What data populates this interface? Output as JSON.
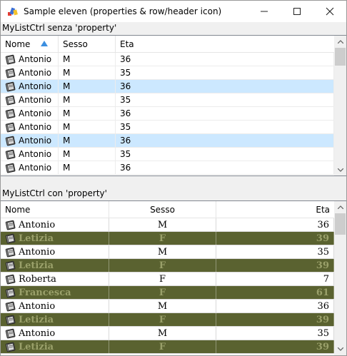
{
  "window": {
    "title": "Sample eleven (properties & row/header icon)",
    "controls": {
      "minimize": "minimize-icon",
      "maximize": "maximize-icon",
      "close": "close-icon"
    }
  },
  "list1": {
    "label": "MyListCtrl senza 'property'",
    "columns": [
      "Nome",
      "Sesso",
      "Eta"
    ],
    "sort_column": "Nome",
    "sort_direction": "ascending",
    "rows": [
      {
        "nome": "Antonio",
        "sesso": "M",
        "eta": "36",
        "selected": false
      },
      {
        "nome": "Antonio",
        "sesso": "M",
        "eta": "35",
        "selected": false
      },
      {
        "nome": "Antonio",
        "sesso": "M",
        "eta": "36",
        "selected": true
      },
      {
        "nome": "Antonio",
        "sesso": "M",
        "eta": "35",
        "selected": false
      },
      {
        "nome": "Antonio",
        "sesso": "M",
        "eta": "36",
        "selected": false
      },
      {
        "nome": "Antonio",
        "sesso": "M",
        "eta": "35",
        "selected": false
      },
      {
        "nome": "Antonio",
        "sesso": "M",
        "eta": "36",
        "selected": true
      },
      {
        "nome": "Antonio",
        "sesso": "M",
        "eta": "35",
        "selected": false
      },
      {
        "nome": "Antonio",
        "sesso": "M",
        "eta": "36",
        "selected": false
      }
    ]
  },
  "list2": {
    "label": "MyListCtrl con 'property'",
    "columns": [
      "Nome",
      "Sesso",
      "Eta"
    ],
    "rows": [
      {
        "nome": "Antonio",
        "sesso": "M",
        "eta": "36",
        "style": "normal"
      },
      {
        "nome": "Letizia",
        "sesso": "F",
        "eta": "39",
        "style": "dark"
      },
      {
        "nome": "Antonio",
        "sesso": "M",
        "eta": "35",
        "style": "normal"
      },
      {
        "nome": "Letizia",
        "sesso": "F",
        "eta": "39",
        "style": "dark"
      },
      {
        "nome": "Roberta",
        "sesso": "F",
        "eta": "7",
        "style": "normal"
      },
      {
        "nome": "Francesca",
        "sesso": "F",
        "eta": "61",
        "style": "dark"
      },
      {
        "nome": "Antonio",
        "sesso": "M",
        "eta": "36",
        "style": "normal"
      },
      {
        "nome": "Letizia",
        "sesso": "F",
        "eta": "39",
        "style": "dark"
      },
      {
        "nome": "Antonio",
        "sesso": "M",
        "eta": "35",
        "style": "normal"
      },
      {
        "nome": "Letizia",
        "sesso": "F",
        "eta": "39",
        "style": "dark"
      }
    ]
  },
  "colors": {
    "selected_row": "#cce8ff",
    "dark_row_bg": "#5a6230",
    "dark_row_text": "#9aa06a",
    "sort_arrow": "#3c8fe0"
  },
  "icons": {
    "app": "app-palette-icon",
    "row": "row-document-icon"
  }
}
